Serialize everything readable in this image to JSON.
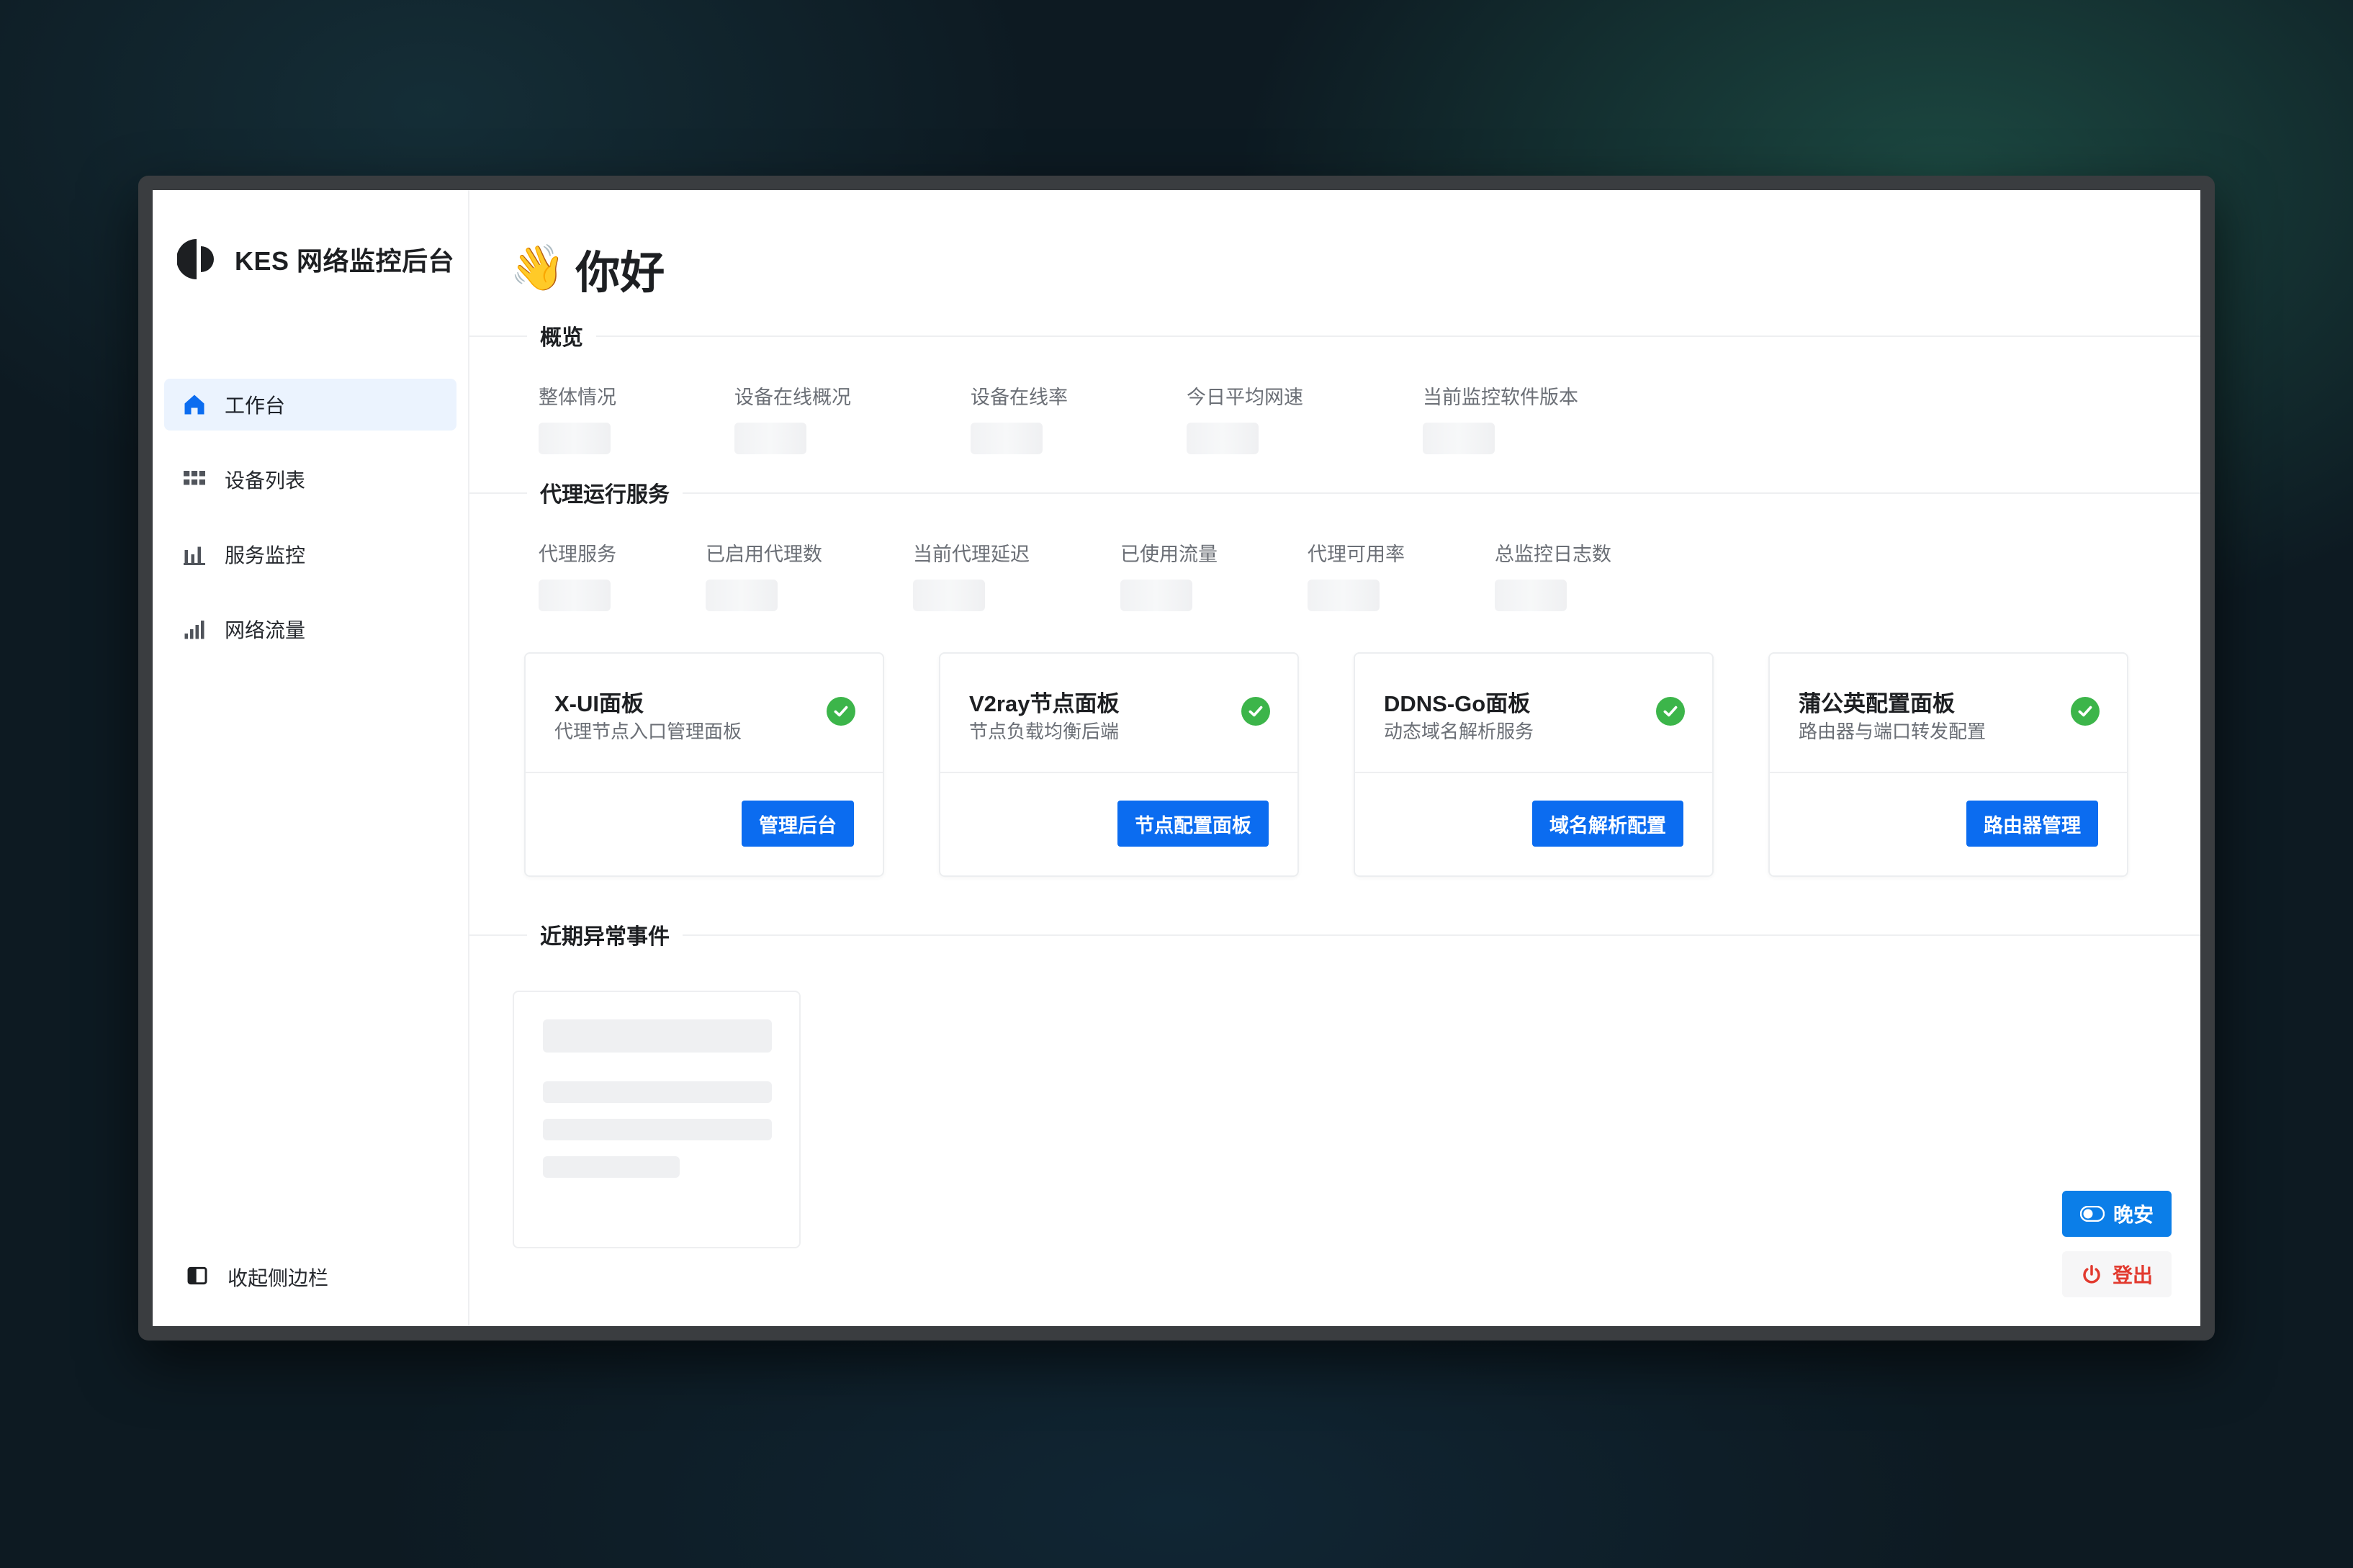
{
  "app": {
    "name": "KES 网络监控后台"
  },
  "sidebar": {
    "items": [
      {
        "label": "工作台",
        "icon": "home-icon",
        "active": true
      },
      {
        "label": "设备列表",
        "icon": "grid-icon",
        "active": false
      },
      {
        "label": "服务监控",
        "icon": "bar-chart-icon",
        "active": false
      },
      {
        "label": "网络流量",
        "icon": "signal-icon",
        "active": false
      }
    ],
    "collapse_label": "收起侧边栏"
  },
  "greeting": {
    "emoji": "👋",
    "text": "你好"
  },
  "overview": {
    "title": "概览",
    "stats": [
      "整体情况",
      "设备在线概况",
      "设备在线率",
      "今日平均网速",
      "当前监控软件版本"
    ]
  },
  "proxy": {
    "title": "代理运行服务",
    "stats": [
      "代理服务",
      "已启用代理数",
      "当前代理延迟",
      "已使用流量",
      "代理可用率",
      "总监控日志数"
    ]
  },
  "panels": [
    {
      "name": "X-UI面板",
      "desc": "代理节点入口管理面板",
      "button": "管理后台"
    },
    {
      "name": "V2ray节点面板",
      "desc": "节点负载均衡后端",
      "button": "节点配置面板"
    },
    {
      "name": "DDNS-Go面板",
      "desc": "动态域名解析服务",
      "button": "域名解析配置"
    },
    {
      "name": "蒲公英配置面板",
      "desc": "路由器与端口转发配置",
      "button": "路由器管理"
    }
  ],
  "events": {
    "title": "近期异常事件"
  },
  "actions": {
    "theme_label": "晚安",
    "logout_label": "登出"
  },
  "colors": {
    "primary": "#0b6cf0",
    "success": "#3cb54a",
    "danger": "#e23a2f",
    "active_bg": "#ebf3fe"
  }
}
